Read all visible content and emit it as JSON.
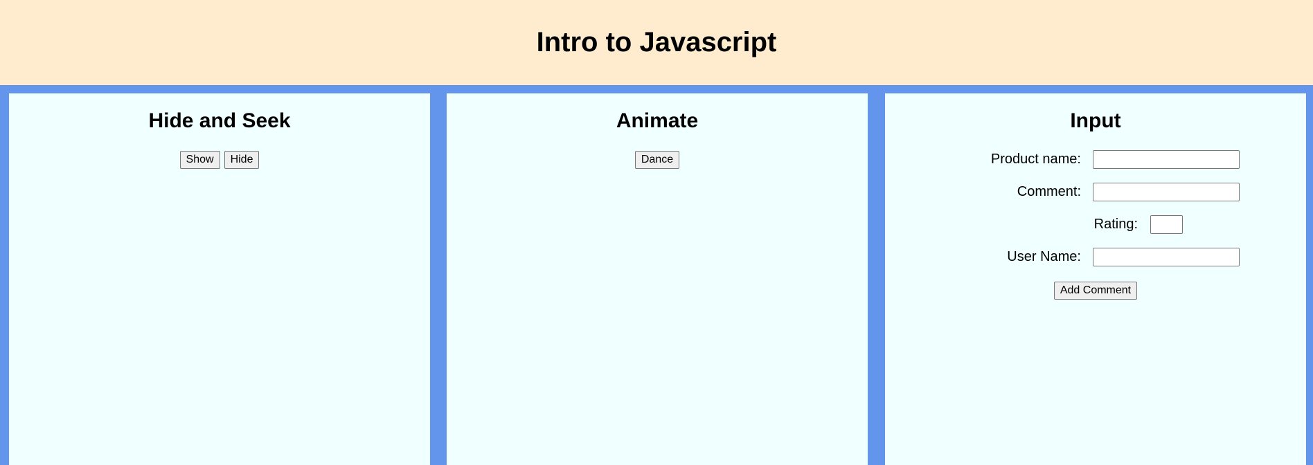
{
  "header": {
    "title": "Intro to Javascript"
  },
  "panels": {
    "hide_seek": {
      "title": "Hide and Seek",
      "show_label": "Show",
      "hide_label": "Hide"
    },
    "animate": {
      "title": "Animate",
      "dance_label": "Dance"
    },
    "input": {
      "title": "Input",
      "product_name_label": "Product name:",
      "product_name_value": "",
      "comment_label": "Comment:",
      "comment_value": "",
      "rating_label": "Rating:",
      "rating_value": "",
      "user_name_label": "User Name:",
      "user_name_value": "",
      "add_comment_label": "Add Comment"
    }
  },
  "colors": {
    "header_bg": "#FFEBCD",
    "page_bg": "#6495ED",
    "panel_bg": "#F0FFFF"
  }
}
